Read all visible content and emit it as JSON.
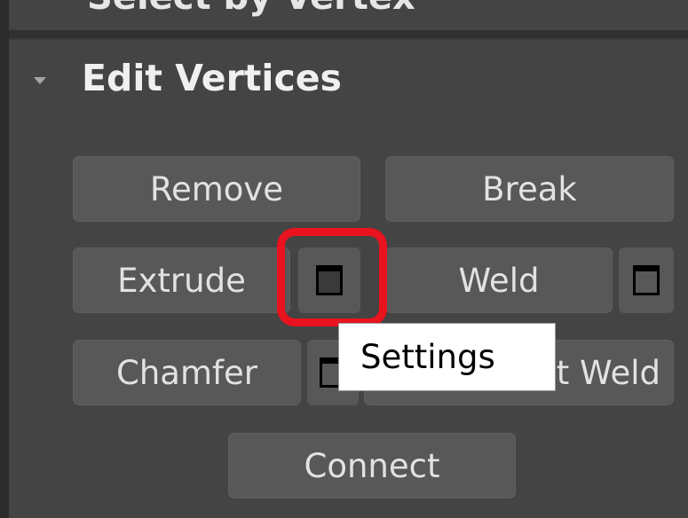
{
  "rollout": {
    "title": "Edit Vertices",
    "previous_rollout_label": "Select by Vertex"
  },
  "buttons": {
    "remove": "Remove",
    "break": "Break",
    "extrude": "Extrude",
    "weld": "Weld",
    "chamfer": "Chamfer",
    "target_weld": "Target Weld",
    "connect": "Connect"
  },
  "tooltip": {
    "text": "Settings"
  },
  "colors": {
    "panel_bg": "#444444",
    "button_bg": "#585858",
    "highlight": "#e8131e",
    "tooltip_bg": "#ffffff"
  },
  "icons": {
    "collapse": "triangle-down-icon",
    "settings": "settings-window-icon"
  }
}
